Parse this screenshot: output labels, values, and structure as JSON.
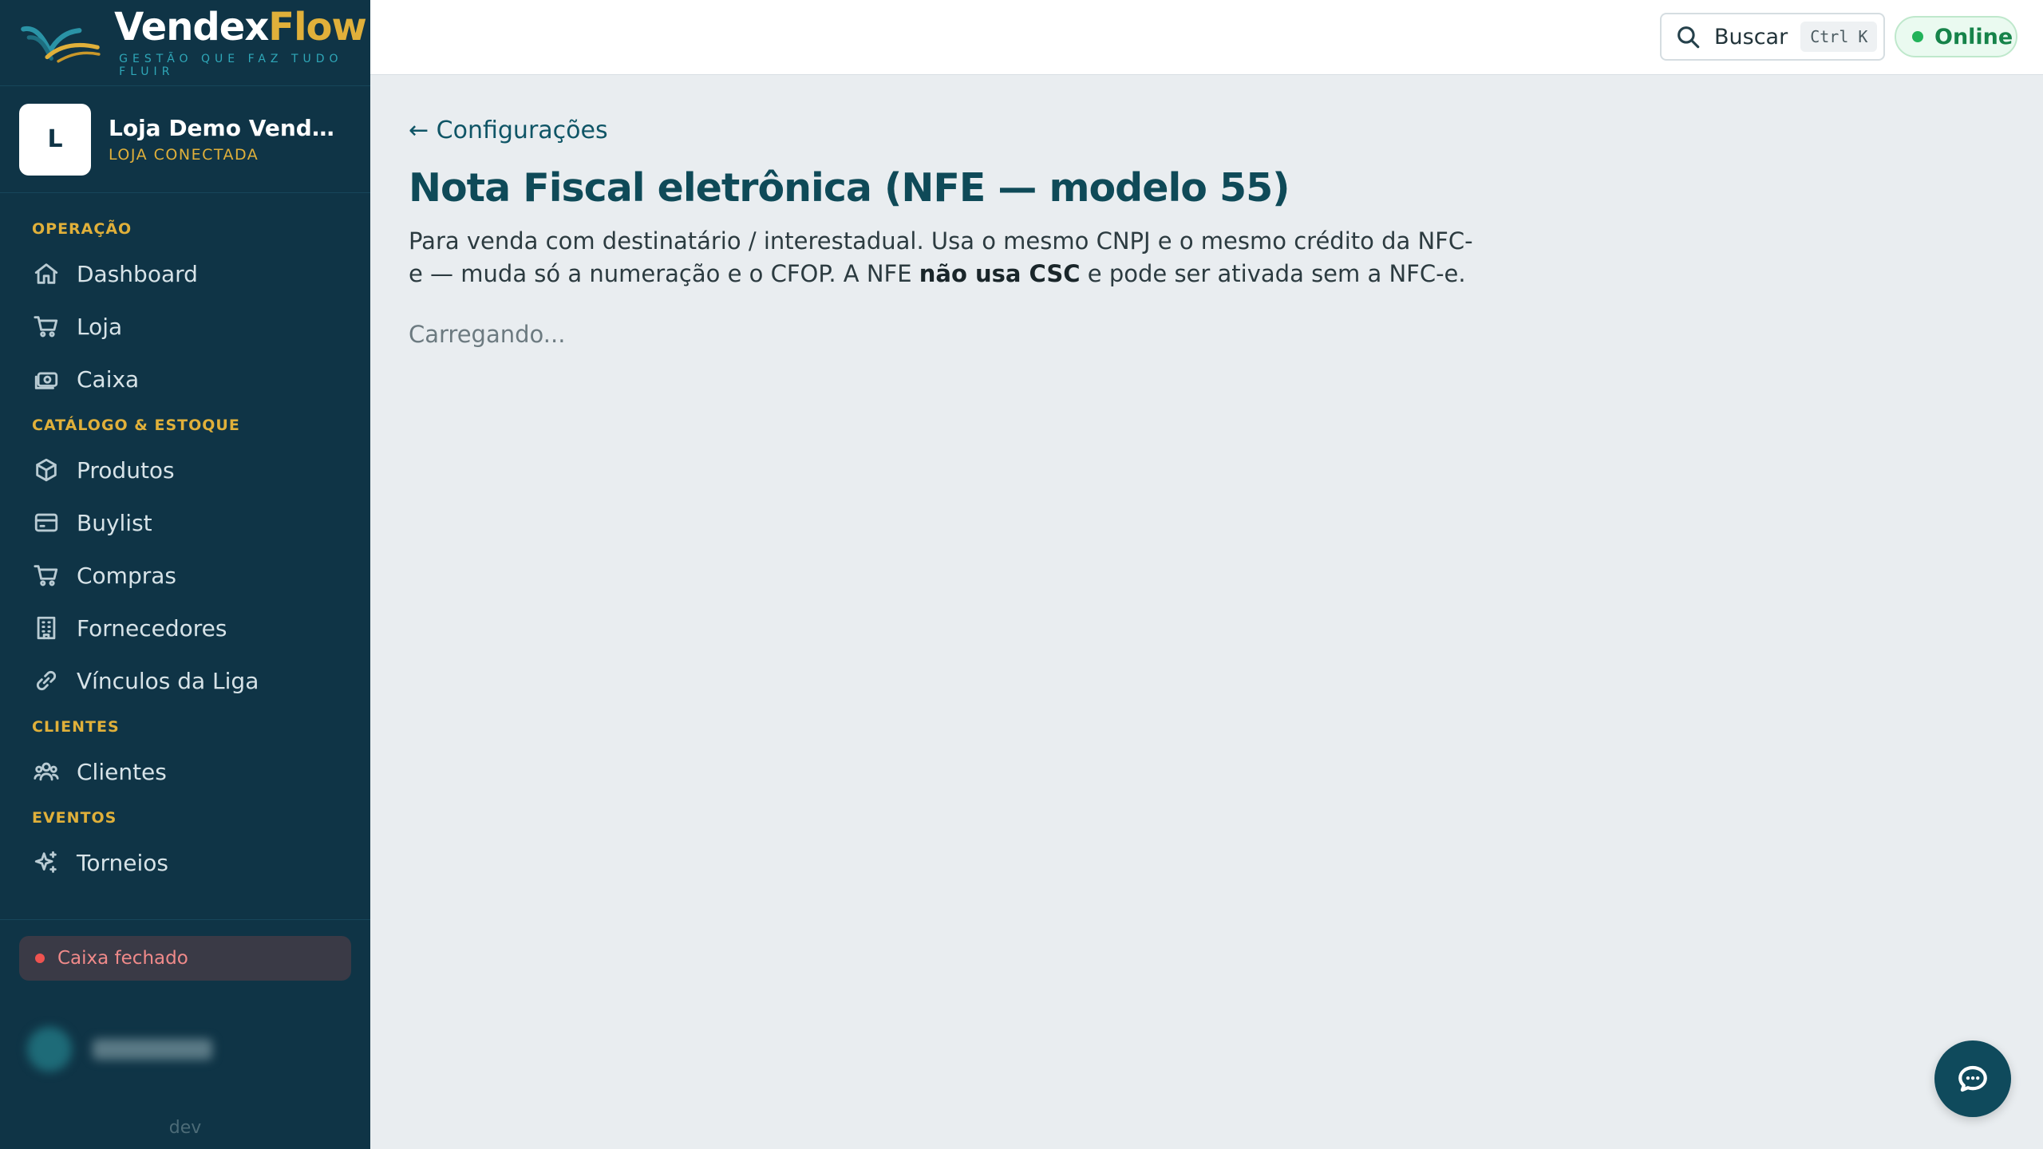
{
  "brand": {
    "name_part1": "Vendex",
    "name_part2": "Flow",
    "tagline": "GESTÃO QUE FAZ TUDO FLUIR"
  },
  "store": {
    "initial": "L",
    "name": "Loja Demo VendexFlow",
    "status": "LOJA CONECTADA"
  },
  "nav": {
    "sections": [
      {
        "title": "OPERAÇÃO",
        "items": [
          {
            "label": "Dashboard",
            "icon": "home-icon"
          },
          {
            "label": "Loja",
            "icon": "cart-icon"
          },
          {
            "label": "Caixa",
            "icon": "cash-register-icon"
          }
        ]
      },
      {
        "title": "CATÁLOGO & ESTOQUE",
        "items": [
          {
            "label": "Produtos",
            "icon": "box-icon"
          },
          {
            "label": "Buylist",
            "icon": "card-icon"
          },
          {
            "label": "Compras",
            "icon": "cart-icon"
          },
          {
            "label": "Fornecedores",
            "icon": "building-icon"
          },
          {
            "label": "Vínculos da Liga",
            "icon": "link-icon"
          }
        ]
      },
      {
        "title": "CLIENTES",
        "items": [
          {
            "label": "Clientes",
            "icon": "users-icon"
          }
        ]
      },
      {
        "title": "EVENTOS",
        "items": [
          {
            "label": "Torneios",
            "icon": "sparkle-icon"
          }
        ]
      }
    ]
  },
  "sidebar_bottom": {
    "caixa_status": "Caixa fechado",
    "env": "dev"
  },
  "topbar": {
    "search_label": "Buscar",
    "search_shortcut": "Ctrl K",
    "status": "Online"
  },
  "main": {
    "back_link": "← Configurações",
    "title": "Nota Fiscal eletrônica (NFE — modelo 55)",
    "desc_part1": "Para venda com destinatário / interestadual. Usa o mesmo CNPJ e o mesmo crédito da NFC-e — muda só a numeração e o CFOP. A NFE ",
    "desc_bold": "não usa CSC",
    "desc_part2": " e pode ser ativada sem a NFC-e.",
    "loading": "Carregando..."
  },
  "colors": {
    "sidebar_bg": "#0f3446",
    "accent_gold": "#e0b03a",
    "title_teal": "#0f4a58",
    "online_green": "#16834a",
    "closed_red": "#ef5350"
  }
}
